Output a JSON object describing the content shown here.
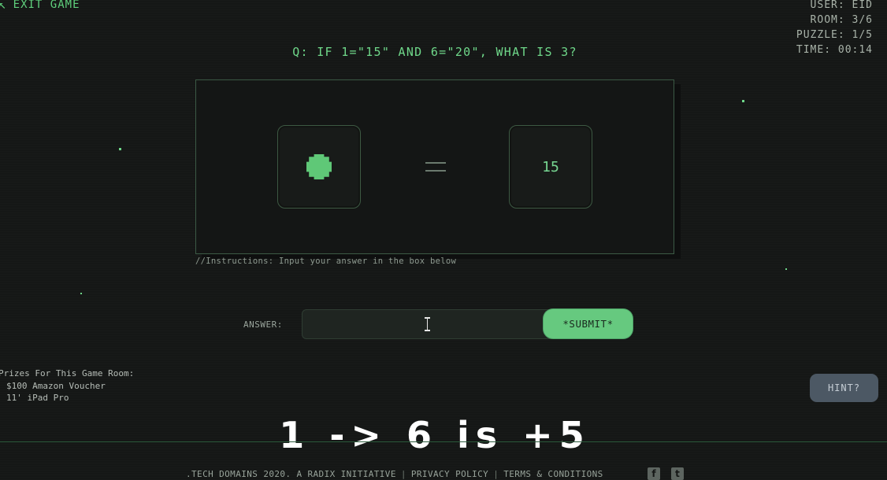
{
  "nav": {
    "exit_label": "EXIT GAME"
  },
  "stats": {
    "user": "USER: EID",
    "room": "ROOM: 3/6",
    "puzzle": "PUZZLE: 1/5",
    "time": "TIME: 00:14"
  },
  "question": "Q: IF 1=\"15\" AND 6=\"20\", WHAT IS 3?",
  "puzzle": {
    "right_value": "15"
  },
  "instructions": "//Instructions: Input your answer in the box below",
  "answer": {
    "label": "ANSWER:",
    "value": "",
    "placeholder": "",
    "submit_label": "*SUBMIT*"
  },
  "prizes": {
    "heading": "Prizes For This Game Room:",
    "items": [
      "$100 Amazon Voucher",
      "11' iPad Pro"
    ]
  },
  "hint_label": "HINT?",
  "caption": "1 -> 6 is +5",
  "footer": {
    "copyright": ".TECH DOMAINS 2020. A RADIX INITIATIVE",
    "privacy": "PRIVACY POLICY",
    "terms": "TERMS & CONDITIONS",
    "separator": "|"
  },
  "social": {
    "facebook_glyph": "f",
    "twitter_glyph": "t"
  },
  "colors": {
    "accent": "#66c97f",
    "background": "#151716",
    "hint": "#4c5864"
  }
}
